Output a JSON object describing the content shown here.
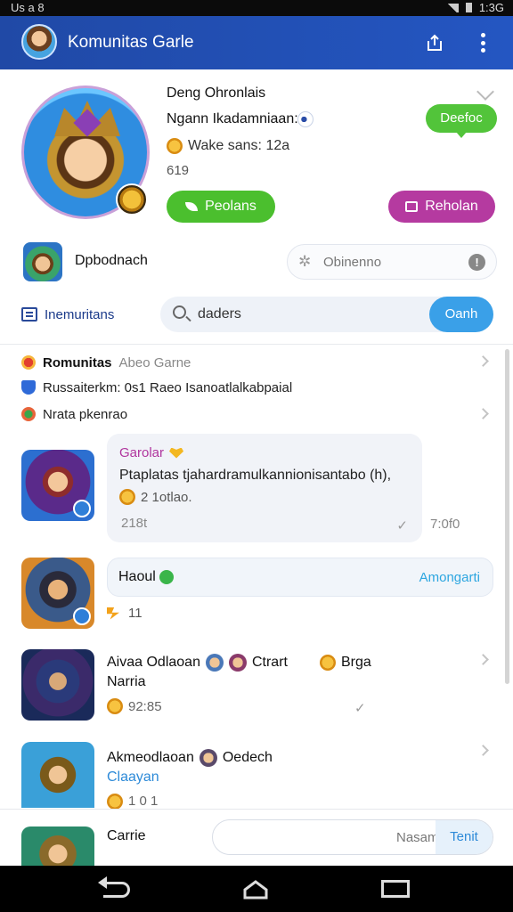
{
  "status": {
    "left": "Us a 8",
    "time": "1:3G"
  },
  "app": {
    "title": "Komunitas Garle"
  },
  "profile": {
    "name": "Deng Ohronlais",
    "subtitle": "Ngann Ikadamniaan:",
    "meta": "Wake sans: 12a",
    "number": "619",
    "bubble_label": "Deefoc",
    "btn_primary": "Peolans",
    "btn_secondary": "Reholan"
  },
  "group": {
    "title": "Dpbodnach",
    "notice": "Obinenno"
  },
  "toolbar": {
    "tab_label": "Inemuritans",
    "search_value": "daders",
    "search_button": "Oanh"
  },
  "info_rows": [
    {
      "bold": "Romunitas",
      "muted": "Abeo Garne"
    },
    {
      "text": "Russaiterkm: 0s1 Raeo Isanoatlalkabpaial"
    },
    {
      "text": "Nrata pkenrao"
    }
  ],
  "posts": {
    "first": {
      "name": "Garolar",
      "message": "Ptaplatas tjahardramulkannionisantabo (h),",
      "sub": "2 1otlao.",
      "timestamp": "218t",
      "check": "✓",
      "outside_time": "7:0f0"
    },
    "second": {
      "name": "Haoul",
      "action": "Amongarti",
      "count": "11"
    },
    "third": {
      "name": "Aivaa Odlaoan",
      "tag1": "Ctrart",
      "tag2": "Brga",
      "sub": "Narria",
      "meta": "92:85",
      "check": "✓"
    },
    "fourth": {
      "name": "Akmeodlaoan",
      "tag": "Oedech",
      "sub": "Claayan",
      "meta": "1 0 1"
    }
  },
  "composer": {
    "label": "Carrie",
    "placeholder": "",
    "hint": "Nasam",
    "send": "Tenit"
  },
  "colors": {
    "appbar": "#2049a6",
    "green": "#4bbf2e",
    "purple": "#b53aa0",
    "accent_blue": "#3aa0e8"
  }
}
